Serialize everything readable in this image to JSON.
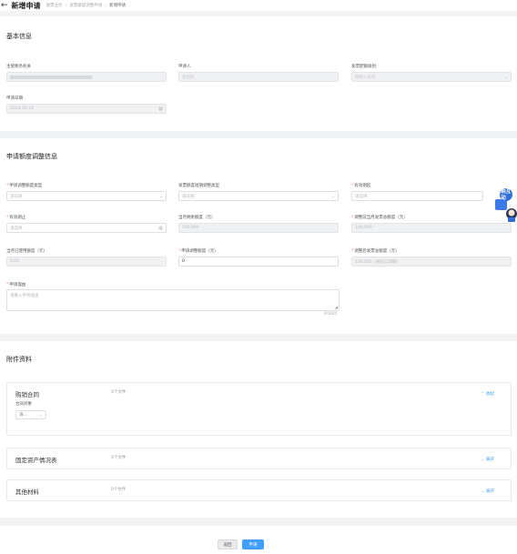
{
  "header": {
    "title": "新增申请",
    "breadcrumb": [
      "发票业务",
      "发票额度调整申请",
      "新增申请"
    ]
  },
  "basic": {
    "title": "基本信息",
    "authority_label": "主管税务机关",
    "applicant_label": "申请人",
    "applicant_value": "张国栋",
    "level_label": "发票配额级别",
    "level_value": "纳税人级别",
    "date_label": "申请日期",
    "date_value": "2024-05-24"
  },
  "adjust": {
    "title": "申请额度调整信息",
    "type_label": "申请调整额度类型",
    "type_placeholder": "请选择",
    "longterm_label": "发票额度短期调整类型",
    "longterm_placeholder": "请选择",
    "start_label": "有效期起",
    "start_placeholder": "请选择",
    "end_label": "有效期止",
    "end_placeholder": "请选择",
    "remaining_label": "当月剩余额度（元）",
    "remaining_value": "100,000",
    "before_label": "调整前当月发票总额度（元）",
    "before_value": "100,000",
    "used_label": "当月已使用额度（元）",
    "used_value": "0.00",
    "amount_label": "申请调整额度（元）",
    "amount_value": "0",
    "after_label": "调整后发票总额度（元）",
    "after_value": "100,000（按化口调额）",
    "reason_label": "申请理由",
    "reason_placeholder": "请输入申请理由",
    "reason_counter": "0/1000"
  },
  "attachments": {
    "title": "附件资料",
    "items": [
      {
        "name": "购销合同",
        "count": "0个文件",
        "toggle": "收起",
        "sub_label": "合同对象",
        "sub_value": "请..."
      },
      {
        "name": "固定资产情况表",
        "count": "0个文件",
        "toggle": "展开"
      },
      {
        "name": "其他材料",
        "count": "0个文件",
        "toggle": "展开"
      }
    ]
  },
  "mascot": {
    "text": "征纳互动"
  },
  "footer": {
    "back_label": "返回",
    "submit_label": "申请"
  },
  "colors": {
    "primary": "#409eff",
    "required": "#f56c6c",
    "disabled_bg": "#f0f1f3"
  }
}
